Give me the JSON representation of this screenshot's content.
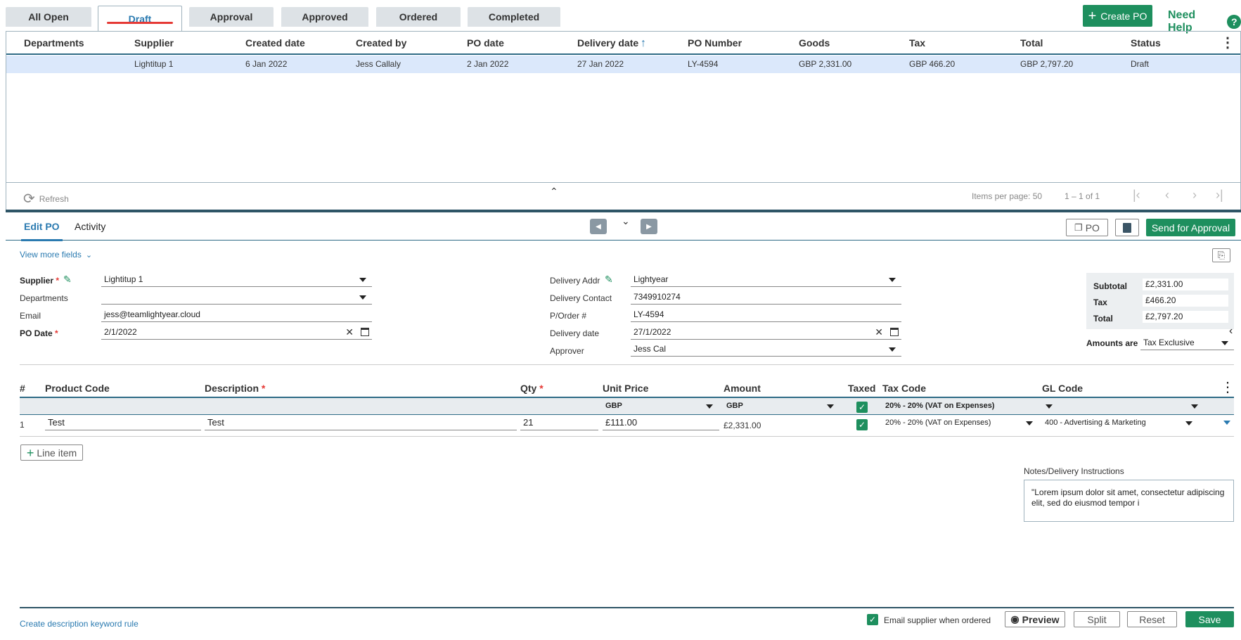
{
  "tabs": [
    {
      "label": "All Open"
    },
    {
      "label": "Draft"
    },
    {
      "label": "Approval"
    },
    {
      "label": "Approved"
    },
    {
      "label": "Ordered"
    },
    {
      "label": "Completed"
    }
  ],
  "header": {
    "create_po_label": "Create PO",
    "need_help_label": "Need Help",
    "help_glyph": "?"
  },
  "grid": {
    "columns": [
      "Departments",
      "Supplier",
      "Created date",
      "Created by",
      "PO date",
      "Delivery date",
      "PO Number",
      "Goods",
      "Tax",
      "Total",
      "Status"
    ],
    "sort_indicator": "↑",
    "rows": [
      {
        "department": "",
        "supplier": "Lightitup 1",
        "created_date": "6 Jan 2022",
        "created_by": "Jess Callaly",
        "po_date": "2 Jan 2022",
        "delivery_date": "27 Jan 2022",
        "po_number": "LY-4594",
        "goods": "GBP 2,331.00",
        "tax": "GBP 466.20",
        "total": "GBP 2,797.20",
        "status": "Draft"
      }
    ],
    "refresh_label": "Refresh",
    "items_per_page_label": "Items per page: 50",
    "range_label": "1 – 1 of 1"
  },
  "edit": {
    "tabs": [
      "Edit PO",
      "Activity"
    ],
    "po_button_label": "PO",
    "send_for_approval_label": "Send for Approval",
    "view_more_label": "View more fields",
    "supplier_label": "Supplier",
    "supplier_value": "Lightitup 1",
    "departments_label": "Departments",
    "departments_value": "",
    "email_label": "Email",
    "email_value": "jess@teamlightyear.cloud",
    "po_date_label": "PO Date",
    "po_date_value": "2/1/2022",
    "delivery_addr_label": "Delivery Addr",
    "delivery_addr_value": "Lightyear",
    "delivery_contact_label": "Delivery Contact",
    "delivery_contact_value": "7349910274",
    "porder_label": "P/Order #",
    "porder_value": "LY-4594",
    "delivery_date_label": "Delivery date",
    "delivery_date_value": "27/1/2022",
    "approver_label": "Approver",
    "approver_value": "Jess Cal",
    "subtotal_label": "Subtotal",
    "subtotal_value": "£2,331.00",
    "tax_label": "Tax",
    "tax_value": "£466.20",
    "total_label": "Total",
    "total_value": "£2,797.20",
    "amounts_are_label": "Amounts are",
    "amounts_are_value": "Tax Exclusive"
  },
  "lines": {
    "columns": {
      "num": "#",
      "product_code": "Product Code",
      "description": "Description",
      "qty": "Qty",
      "unit_price": "Unit Price",
      "amount": "Amount",
      "taxed": "Taxed",
      "tax_code": "Tax Code",
      "gl_code": "GL Code"
    },
    "defaults": {
      "unit_price_currency": "GBP",
      "amount_currency": "GBP",
      "tax_code": "20% - 20% (VAT on Expenses)",
      "gl_code": ""
    },
    "rows": [
      {
        "num": "1",
        "product_code": "Test",
        "description": "Test",
        "qty": "21",
        "unit_price": "£111.00",
        "amount": "£2,331.00",
        "tax_code": "20% - 20% (VAT on Expenses)",
        "gl_code": "400 - Advertising & Marketing"
      }
    ],
    "add_line_label": "Line item"
  },
  "notes": {
    "label": "Notes/Delivery Instructions",
    "value": "\"Lorem ipsum dolor sit amet, consectetur adipiscing elit, sed do eiusmod tempor i"
  },
  "footer": {
    "keyword_rule_label": "Create description keyword rule",
    "email_supplier_label": "Email supplier when ordered",
    "preview_label": "Preview",
    "split_label": "Split",
    "reset_label": "Reset",
    "save_label": "Save"
  },
  "colors": {
    "accent_green": "#1e8f5e",
    "accent_blue": "#2a7ab0",
    "selected_row": "#dbe8fb",
    "required_red": "#e53935"
  }
}
